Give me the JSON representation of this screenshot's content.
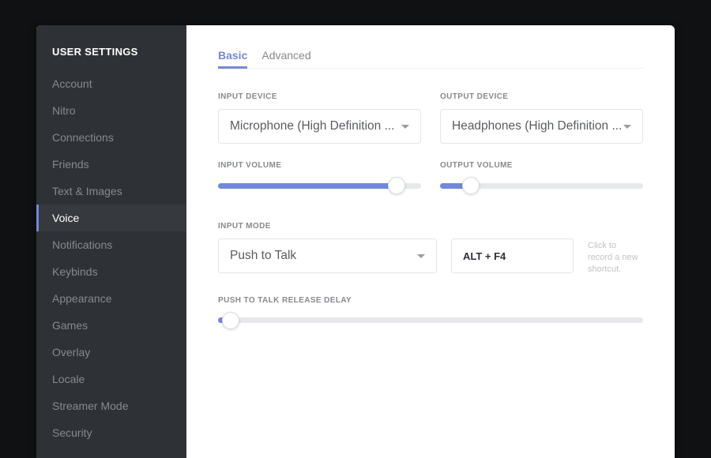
{
  "colors": {
    "accent": "#7289da"
  },
  "sidebar": {
    "title": "USER SETTINGS",
    "items": [
      {
        "label": "Account"
      },
      {
        "label": "Nitro"
      },
      {
        "label": "Connections"
      },
      {
        "label": "Friends"
      },
      {
        "label": "Text & Images"
      },
      {
        "label": "Voice"
      },
      {
        "label": "Notifications"
      },
      {
        "label": "Keybinds"
      },
      {
        "label": "Appearance"
      },
      {
        "label": "Games"
      },
      {
        "label": "Overlay"
      },
      {
        "label": "Locale"
      },
      {
        "label": "Streamer Mode"
      },
      {
        "label": "Security"
      }
    ],
    "active_index": 5
  },
  "tabs": {
    "items": [
      {
        "label": "Basic"
      },
      {
        "label": "Advanced"
      }
    ],
    "active_index": 0
  },
  "devices": {
    "input_label": "INPUT DEVICE",
    "input_value": "Microphone (High Definition ...",
    "output_label": "OUTPUT DEVICE",
    "output_value": "Headphones (High Definition ..."
  },
  "volumes": {
    "input_label": "INPUT VOLUME",
    "input_percent": 88,
    "output_label": "OUTPUT VOLUME",
    "output_percent": 15
  },
  "input_mode": {
    "label": "INPUT MODE",
    "value": "Push to Talk",
    "shortcut": "ALT + F4",
    "hint": "Click to record a new shortcut."
  },
  "release_delay": {
    "label": "PUSH TO TALK RELEASE DELAY",
    "percent": 3
  }
}
